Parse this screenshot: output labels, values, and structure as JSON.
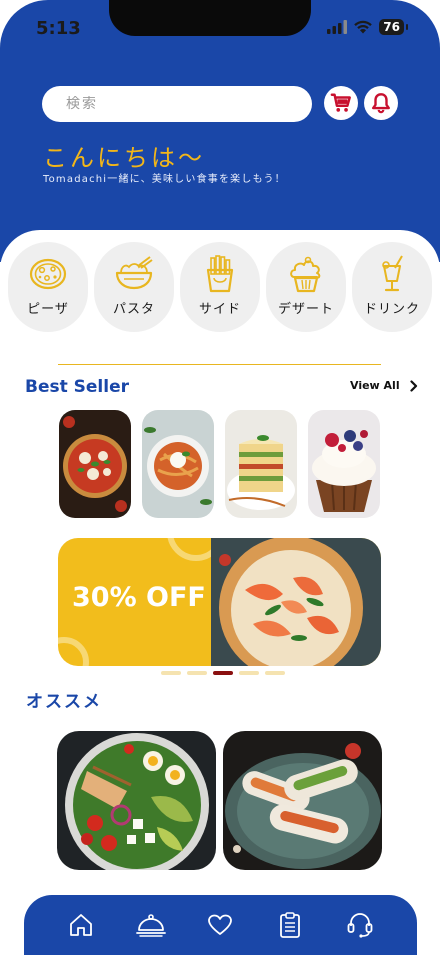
{
  "status": {
    "time": "5:13",
    "battery": "76"
  },
  "search": {
    "placeholder": "検索"
  },
  "header": {
    "greeting": "こんにちは〜",
    "subtitle": "Tomadachi一緒に、美味しい食事を楽しもう！"
  },
  "categories": [
    {
      "label": "ピーザ",
      "icon": "pizza-icon"
    },
    {
      "label": "パスタ",
      "icon": "noodle-bowl-icon"
    },
    {
      "label": "サイド",
      "icon": "fries-icon"
    },
    {
      "label": "デザート",
      "icon": "cupcake-icon"
    },
    {
      "label": "ドリンク",
      "icon": "drink-icon"
    }
  ],
  "best_seller": {
    "title": "Best Seller",
    "view_all": "View All",
    "items": [
      "pizza",
      "pasta",
      "lasagna",
      "cupcake"
    ]
  },
  "promo": {
    "text": "30% OFF",
    "slide_count": 5,
    "active_slide": 3
  },
  "recommend": {
    "title": "オススメ",
    "items": [
      "salad",
      "spring-rolls"
    ]
  },
  "nav": [
    "home-icon",
    "cloche-icon",
    "heart-icon",
    "clipboard-icon",
    "support-headset-icon"
  ],
  "colors": {
    "primary": "#1a47a8",
    "accent": "#f2b619",
    "promo_bg": "#f2bd1c",
    "active_dot": "#8a1010"
  }
}
